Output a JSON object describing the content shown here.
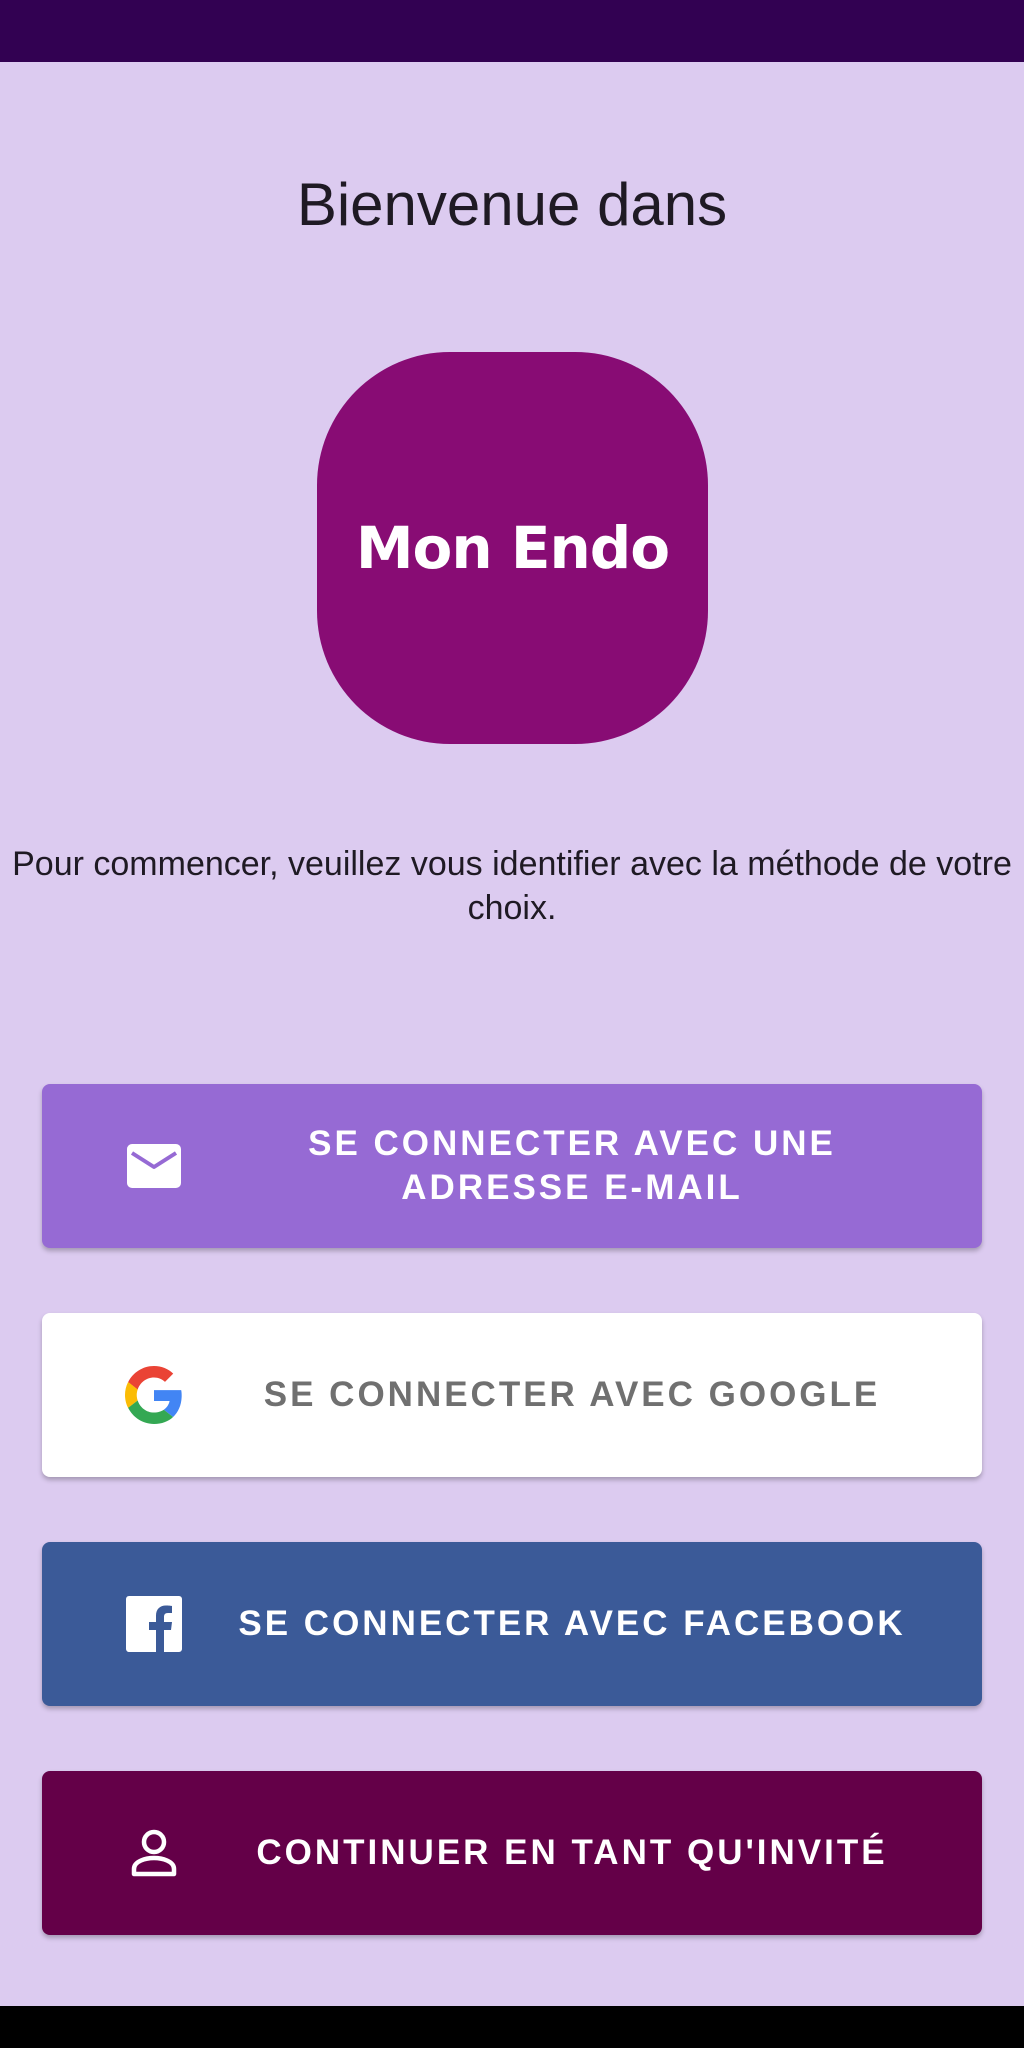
{
  "header": {
    "welcome": "Bienvenue dans"
  },
  "logo": {
    "text": "Mon Endo",
    "color": "#880c74"
  },
  "intro": {
    "text": "Pour commencer, veuillez vous identifier avec la méthode de votre choix."
  },
  "buttons": {
    "email": {
      "label": "SE CONNECTER AVEC UNE ADRESSE E-MAIL",
      "icon": "mail-icon",
      "color": "#966ad4"
    },
    "google": {
      "label": "SE CONNECTER AVEC GOOGLE",
      "icon": "google-icon",
      "color": "#ffffff"
    },
    "facebook": {
      "label": "SE CONNECTER AVEC FACEBOOK",
      "icon": "facebook-icon",
      "color": "#3b5a98"
    },
    "guest": {
      "label": "CONTINUER EN TANT QU'INVITÉ",
      "icon": "person-icon",
      "color": "#640048"
    }
  },
  "colors": {
    "background": "#dccbf0",
    "status_bar": "#320152"
  }
}
